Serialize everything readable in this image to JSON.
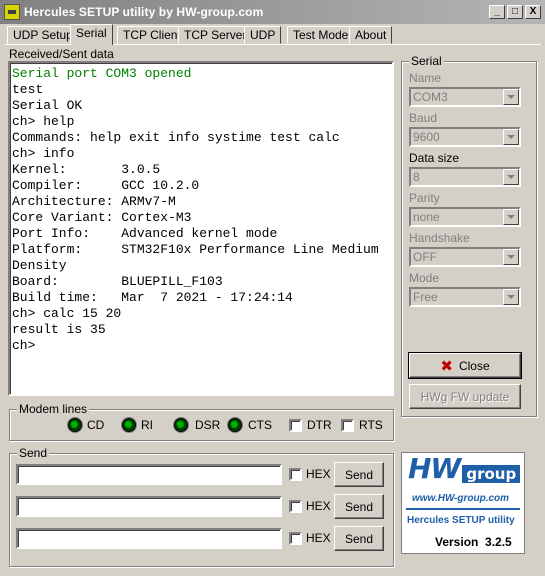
{
  "window": {
    "title": "Hercules SETUP utility by HW-group.com",
    "minimize": "_",
    "maximize": "□",
    "close": "X"
  },
  "tabs": [
    {
      "label": "UDP Setup"
    },
    {
      "label": "Serial"
    },
    {
      "label": "TCP Client"
    },
    {
      "label": "TCP Server"
    },
    {
      "label": "UDP"
    },
    {
      "label": "Test Mode"
    },
    {
      "label": "About"
    }
  ],
  "active_tab": "Serial",
  "received": {
    "label": "Received/Sent data",
    "lines": [
      {
        "text": "Serial port COM3 opened",
        "color": "#008000"
      },
      {
        "text": "test",
        "color": "#000000"
      },
      {
        "text": "Serial OK",
        "color": "#000000"
      },
      {
        "text": "ch> help",
        "color": "#000000"
      },
      {
        "text": "Commands: help exit info systime test calc",
        "color": "#000000"
      },
      {
        "text": "ch> info",
        "color": "#000000"
      },
      {
        "text": "Kernel:       3.0.5",
        "color": "#000000"
      },
      {
        "text": "Compiler:     GCC 10.2.0",
        "color": "#000000"
      },
      {
        "text": "Architecture: ARMv7-M",
        "color": "#000000"
      },
      {
        "text": "Core Variant: Cortex-M3",
        "color": "#000000"
      },
      {
        "text": "Port Info:    Advanced kernel mode",
        "color": "#000000"
      },
      {
        "text": "Platform:     STM32F10x Performance Line Medium",
        "color": "#000000"
      },
      {
        "text": "Density",
        "color": "#000000"
      },
      {
        "text": "Board:        BLUEPILL_F103",
        "color": "#000000"
      },
      {
        "text": "Build time:   Mar  7 2021 - 17:24:14",
        "color": "#000000"
      },
      {
        "text": "ch> calc 15 20",
        "color": "#000000"
      },
      {
        "text": "result is 35",
        "color": "#000000"
      },
      {
        "text": "ch>",
        "color": "#000000"
      }
    ]
  },
  "serial": {
    "label": "Serial",
    "fields": [
      {
        "label": "Name",
        "value": "COM3",
        "enabled": false
      },
      {
        "label": "Baud",
        "value": "9600",
        "enabled": false
      },
      {
        "label": "Data size",
        "value": "8",
        "enabled": true
      },
      {
        "label": "Parity",
        "value": "none",
        "enabled": false
      },
      {
        "label": "Handshake",
        "value": "OFF",
        "enabled": false
      },
      {
        "label": "Mode",
        "value": "Free",
        "enabled": false
      }
    ],
    "close_button": "Close",
    "fw_update_button": "HWg FW update"
  },
  "modem": {
    "label": "Modem lines",
    "leds": [
      "CD",
      "RI",
      "DSR",
      "CTS"
    ],
    "checks": [
      "DTR",
      "RTS"
    ]
  },
  "send": {
    "label": "Send",
    "rows": [
      {
        "value": "",
        "hex_label": "HEX",
        "button": "Send"
      },
      {
        "value": "",
        "hex_label": "HEX",
        "button": "Send"
      },
      {
        "value": "",
        "hex_label": "HEX",
        "button": "Send"
      }
    ]
  },
  "logo": {
    "brand": "HW",
    "group": "group",
    "url": "www.HW-group.com",
    "product": "Hercules SETUP utility",
    "version": "Version  3.2.5"
  },
  "colors": {
    "accent": "#1f5fa8",
    "ok_text": "#008000",
    "led_on": "#00b000"
  }
}
